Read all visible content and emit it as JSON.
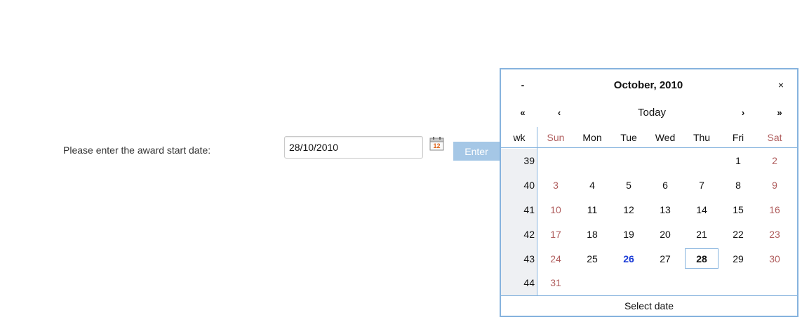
{
  "form": {
    "prompt": "Please enter the award start date:",
    "date_value": "28/10/2010",
    "enter_label": "Enter"
  },
  "calendar": {
    "minus_label": "-",
    "title": "October, 2010",
    "close_label": "×",
    "prev_year_label": "«",
    "prev_month_label": "‹",
    "today_label": "Today",
    "next_month_label": "›",
    "next_year_label": "»",
    "wk_label": "wk",
    "weekdays": [
      "Sun",
      "Mon",
      "Tue",
      "Wed",
      "Thu",
      "Fri",
      "Sat"
    ],
    "weeks": [
      {
        "wk": "39",
        "days": [
          "",
          "",
          "",
          "",
          "",
          "1",
          "2"
        ]
      },
      {
        "wk": "40",
        "days": [
          "3",
          "4",
          "5",
          "6",
          "7",
          "8",
          "9"
        ]
      },
      {
        "wk": "41",
        "days": [
          "10",
          "11",
          "12",
          "13",
          "14",
          "15",
          "16"
        ]
      },
      {
        "wk": "42",
        "days": [
          "17",
          "18",
          "19",
          "20",
          "21",
          "22",
          "23"
        ]
      },
      {
        "wk": "43",
        "days": [
          "24",
          "25",
          "26",
          "27",
          "28",
          "29",
          "30"
        ]
      },
      {
        "wk": "44",
        "days": [
          "31",
          "",
          "",
          "",
          "",
          "",
          ""
        ]
      }
    ],
    "today_day": "26",
    "selected_day": "28",
    "footer": "Select date",
    "colors": {
      "border": "#86b3de",
      "weekend": "#b05e5e",
      "today": "#1a3bd6",
      "button": "#a5c7e6"
    }
  }
}
